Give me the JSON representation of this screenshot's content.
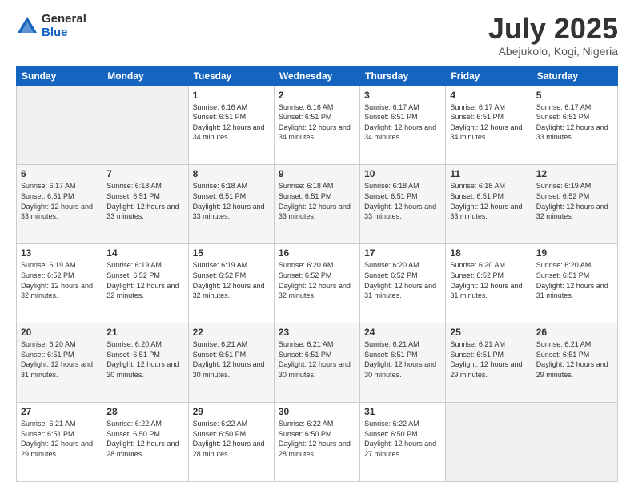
{
  "logo": {
    "general": "General",
    "blue": "Blue"
  },
  "title": "July 2025",
  "location": "Abejukolo, Kogi, Nigeria",
  "days_of_week": [
    "Sunday",
    "Monday",
    "Tuesday",
    "Wednesday",
    "Thursday",
    "Friday",
    "Saturday"
  ],
  "weeks": [
    [
      {
        "day": "",
        "info": ""
      },
      {
        "day": "",
        "info": ""
      },
      {
        "day": "1",
        "info": "Sunrise: 6:16 AM\nSunset: 6:51 PM\nDaylight: 12 hours and 34 minutes."
      },
      {
        "day": "2",
        "info": "Sunrise: 6:16 AM\nSunset: 6:51 PM\nDaylight: 12 hours and 34 minutes."
      },
      {
        "day": "3",
        "info": "Sunrise: 6:17 AM\nSunset: 6:51 PM\nDaylight: 12 hours and 34 minutes."
      },
      {
        "day": "4",
        "info": "Sunrise: 6:17 AM\nSunset: 6:51 PM\nDaylight: 12 hours and 34 minutes."
      },
      {
        "day": "5",
        "info": "Sunrise: 6:17 AM\nSunset: 6:51 PM\nDaylight: 12 hours and 33 minutes."
      }
    ],
    [
      {
        "day": "6",
        "info": "Sunrise: 6:17 AM\nSunset: 6:51 PM\nDaylight: 12 hours and 33 minutes."
      },
      {
        "day": "7",
        "info": "Sunrise: 6:18 AM\nSunset: 6:51 PM\nDaylight: 12 hours and 33 minutes."
      },
      {
        "day": "8",
        "info": "Sunrise: 6:18 AM\nSunset: 6:51 PM\nDaylight: 12 hours and 33 minutes."
      },
      {
        "day": "9",
        "info": "Sunrise: 6:18 AM\nSunset: 6:51 PM\nDaylight: 12 hours and 33 minutes."
      },
      {
        "day": "10",
        "info": "Sunrise: 6:18 AM\nSunset: 6:51 PM\nDaylight: 12 hours and 33 minutes."
      },
      {
        "day": "11",
        "info": "Sunrise: 6:18 AM\nSunset: 6:51 PM\nDaylight: 12 hours and 33 minutes."
      },
      {
        "day": "12",
        "info": "Sunrise: 6:19 AM\nSunset: 6:52 PM\nDaylight: 12 hours and 32 minutes."
      }
    ],
    [
      {
        "day": "13",
        "info": "Sunrise: 6:19 AM\nSunset: 6:52 PM\nDaylight: 12 hours and 32 minutes."
      },
      {
        "day": "14",
        "info": "Sunrise: 6:19 AM\nSunset: 6:52 PM\nDaylight: 12 hours and 32 minutes."
      },
      {
        "day": "15",
        "info": "Sunrise: 6:19 AM\nSunset: 6:52 PM\nDaylight: 12 hours and 32 minutes."
      },
      {
        "day": "16",
        "info": "Sunrise: 6:20 AM\nSunset: 6:52 PM\nDaylight: 12 hours and 32 minutes."
      },
      {
        "day": "17",
        "info": "Sunrise: 6:20 AM\nSunset: 6:52 PM\nDaylight: 12 hours and 31 minutes."
      },
      {
        "day": "18",
        "info": "Sunrise: 6:20 AM\nSunset: 6:52 PM\nDaylight: 12 hours and 31 minutes."
      },
      {
        "day": "19",
        "info": "Sunrise: 6:20 AM\nSunset: 6:51 PM\nDaylight: 12 hours and 31 minutes."
      }
    ],
    [
      {
        "day": "20",
        "info": "Sunrise: 6:20 AM\nSunset: 6:51 PM\nDaylight: 12 hours and 31 minutes."
      },
      {
        "day": "21",
        "info": "Sunrise: 6:20 AM\nSunset: 6:51 PM\nDaylight: 12 hours and 30 minutes."
      },
      {
        "day": "22",
        "info": "Sunrise: 6:21 AM\nSunset: 6:51 PM\nDaylight: 12 hours and 30 minutes."
      },
      {
        "day": "23",
        "info": "Sunrise: 6:21 AM\nSunset: 6:51 PM\nDaylight: 12 hours and 30 minutes."
      },
      {
        "day": "24",
        "info": "Sunrise: 6:21 AM\nSunset: 6:51 PM\nDaylight: 12 hours and 30 minutes."
      },
      {
        "day": "25",
        "info": "Sunrise: 6:21 AM\nSunset: 6:51 PM\nDaylight: 12 hours and 29 minutes."
      },
      {
        "day": "26",
        "info": "Sunrise: 6:21 AM\nSunset: 6:51 PM\nDaylight: 12 hours and 29 minutes."
      }
    ],
    [
      {
        "day": "27",
        "info": "Sunrise: 6:21 AM\nSunset: 6:51 PM\nDaylight: 12 hours and 29 minutes."
      },
      {
        "day": "28",
        "info": "Sunrise: 6:22 AM\nSunset: 6:50 PM\nDaylight: 12 hours and 28 minutes."
      },
      {
        "day": "29",
        "info": "Sunrise: 6:22 AM\nSunset: 6:50 PM\nDaylight: 12 hours and 28 minutes."
      },
      {
        "day": "30",
        "info": "Sunrise: 6:22 AM\nSunset: 6:50 PM\nDaylight: 12 hours and 28 minutes."
      },
      {
        "day": "31",
        "info": "Sunrise: 6:22 AM\nSunset: 6:50 PM\nDaylight: 12 hours and 27 minutes."
      },
      {
        "day": "",
        "info": ""
      },
      {
        "day": "",
        "info": ""
      }
    ]
  ]
}
